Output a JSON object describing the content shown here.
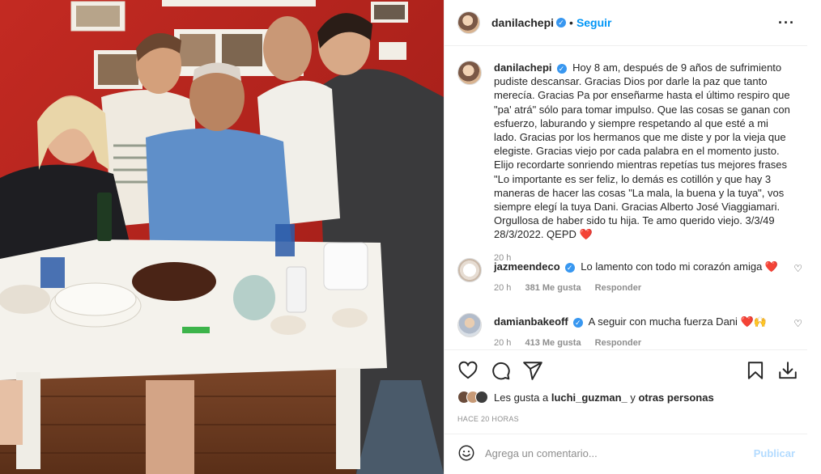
{
  "post": {
    "image_alt": "Foto familiar alrededor de una mesa",
    "username": "danilachepi",
    "follow_label": "Seguir",
    "more_icon": "more-horizontal-icon"
  },
  "caption": {
    "username": "danilachepi",
    "text": "Hoy 8 am, después de 9 años de sufrimiento pudiste descansar. Gracias Dios por darle la paz que tanto merecía. Gracias Pa por enseñarme hasta el último respiro que \"pa' atrá\" sólo para tomar impulso. Que las cosas se ganan con esfuerzo, laburando y siempre respetando al que esté a mi lado. Gracias por los hermanos que me diste y por la vieja que elegiste. Gracias viejo por cada palabra en el momento justo. Elijo recordarte sonriendo mientras repetías tus mejores frases \"Lo importante es ser feliz, lo demás es cotillón y que hay 3 maneras de hacer las cosas \"La mala, la buena y la tuya\", vos siempre elegí la tuya Dani. Gracias Alberto José Viaggiamari. Orgullosa de haber sido tu hija. Te amo querido viejo. 3/3/49 28/3/2022. QEPD",
    "heart": "❤️",
    "time": "20 h"
  },
  "comments": [
    {
      "username": "jazmeendeco",
      "text": "Lo lamento con todo mi corazón amiga",
      "emoji": "❤️",
      "time": "20 h",
      "likes": "381 Me gusta",
      "reply": "Responder"
    },
    {
      "username": "damianbakeoff",
      "text": "A seguir con mucha fuerza Dani",
      "emoji": "❤️🙌",
      "time": "20 h",
      "likes": "413 Me gusta",
      "reply": "Responder"
    }
  ],
  "actions": {
    "like_icon": "heart-outline-icon",
    "comment_icon": "comment-icon",
    "share_icon": "send-icon",
    "save_icon": "bookmark-icon",
    "download_icon": "download-icon"
  },
  "likes": {
    "prefix": "Les gusta a ",
    "user": "luchi_guzman_",
    "connector": " y ",
    "others": "otras personas"
  },
  "time_ago": "HACE 20 HORAS",
  "add_comment": {
    "placeholder": "Agrega un comentario...",
    "publish_label": "Publicar"
  },
  "colors": {
    "accent": "#0095f6",
    "verified": "#3897f0",
    "wall_red": "#b5231c",
    "heart_red": "#ed1c24"
  }
}
